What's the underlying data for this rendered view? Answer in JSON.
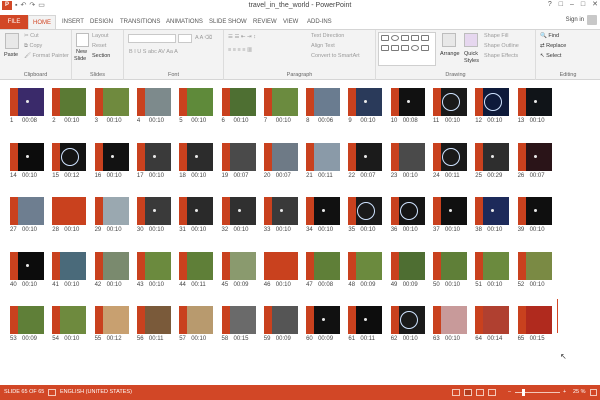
{
  "window": {
    "app_icon_letter": "P",
    "title": "travel_in_the_world - PowerPoint",
    "qat_icons": [
      "save-icon",
      "undo-icon",
      "redo-icon",
      "present-icon"
    ],
    "controls": [
      "?",
      "□",
      "–",
      "□",
      "✕"
    ]
  },
  "tabs": [
    {
      "label": "FILE"
    },
    {
      "label": "HOME"
    },
    {
      "label": "INSERT"
    },
    {
      "label": "DESIGN"
    },
    {
      "label": "TRANSITIONS"
    },
    {
      "label": "ANIMATIONS"
    },
    {
      "label": "SLIDE SHOW"
    },
    {
      "label": "REVIEW"
    },
    {
      "label": "VIEW"
    },
    {
      "label": "ADD-INS"
    }
  ],
  "sign_in": "Sign in",
  "ribbon": {
    "clipboard": {
      "label": "Clipboard",
      "paste": "Paste",
      "cut": "Cut",
      "copy": "Copy",
      "format_painter": "Format Painter"
    },
    "slides": {
      "label": "Slides",
      "new_slide": "New",
      "new_slide_2": "Slide",
      "layout": "Layout",
      "reset": "Reset",
      "section": "Section"
    },
    "font": {
      "label": "Font"
    },
    "paragraph": {
      "label": "Paragraph",
      "text_direction": "Text Direction",
      "align_text": "Align Text",
      "convert": "Convert to SmartArt"
    },
    "drawing": {
      "label": "Drawing",
      "arrange": "Arrange",
      "quick_styles": "Quick",
      "quick_styles_2": "Styles",
      "shape_fill": "Shape Fill",
      "shape_outline": "Shape Outline",
      "shape_effects": "Shape Effects"
    },
    "editing": {
      "label": "Editing",
      "find": "Find",
      "replace": "Replace",
      "select": "Select"
    }
  },
  "slides": [
    {
      "n": "1",
      "t": "00:08",
      "c": "#3a2a6a"
    },
    {
      "n": "2",
      "t": "00:10",
      "c": "#5b7a34"
    },
    {
      "n": "3",
      "t": "00:10",
      "c": "#6f8a3e"
    },
    {
      "n": "4",
      "t": "00:10",
      "c": "#7d8a8c"
    },
    {
      "n": "5",
      "t": "00:10",
      "c": "#5f8a3a"
    },
    {
      "n": "6",
      "t": "00:10",
      "c": "#4e6f32"
    },
    {
      "n": "7",
      "t": "00:10",
      "c": "#6b8b3f"
    },
    {
      "n": "8",
      "t": "00:06",
      "c": "#6a7c90"
    },
    {
      "n": "9",
      "t": "00:10",
      "c": "#2a3a5a"
    },
    {
      "n": "10",
      "t": "00:08",
      "c": "#111111"
    },
    {
      "n": "11",
      "t": "00:10",
      "c": "#1a1a1a"
    },
    {
      "n": "12",
      "t": "00:10",
      "c": "#0e1a3a"
    },
    {
      "n": "13",
      "t": "00:10",
      "c": "#101418"
    },
    {
      "n": "14",
      "t": "00:10",
      "c": "#0c0c0c"
    },
    {
      "n": "15",
      "t": "00:12",
      "c": "#141414"
    },
    {
      "n": "16",
      "t": "00:10",
      "c": "#121212"
    },
    {
      "n": "17",
      "t": "00:10",
      "c": "#3a3a3a"
    },
    {
      "n": "18",
      "t": "00:10",
      "c": "#2c2c2c"
    },
    {
      "n": "19",
      "t": "00:07",
      "c": "#4a4a4a"
    },
    {
      "n": "20",
      "t": "00:07",
      "c": "#6e7a86"
    },
    {
      "n": "21",
      "t": "00:11",
      "c": "#8a9aa8"
    },
    {
      "n": "22",
      "t": "00:07",
      "c": "#1b1b1b"
    },
    {
      "n": "23",
      "t": "00:10",
      "c": "#4a4a4a"
    },
    {
      "n": "24",
      "t": "00:11",
      "c": "#1a1a1a"
    },
    {
      "n": "25",
      "t": "00:29",
      "c": "#2e2e2e"
    },
    {
      "n": "26",
      "t": "00:07",
      "c": "#2a1418"
    },
    {
      "n": "27",
      "t": "00:10",
      "c": "#6e7e90"
    },
    {
      "n": "28",
      "t": "00:10",
      "c": "#c9411e"
    },
    {
      "n": "29",
      "t": "00:10",
      "c": "#9aa8b0"
    },
    {
      "n": "30",
      "t": "00:10",
      "c": "#3a3a3a"
    },
    {
      "n": "31",
      "t": "00:10",
      "c": "#2a2a2a"
    },
    {
      "n": "32",
      "t": "00:10",
      "c": "#303030"
    },
    {
      "n": "33",
      "t": "00:10",
      "c": "#3a3a3a"
    },
    {
      "n": "34",
      "t": "00:10",
      "c": "#111111"
    },
    {
      "n": "35",
      "t": "00:10",
      "c": "#1a1a1a"
    },
    {
      "n": "36",
      "t": "00:10",
      "c": "#151515"
    },
    {
      "n": "37",
      "t": "00:10",
      "c": "#101010"
    },
    {
      "n": "38",
      "t": "00:10",
      "c": "#1d2a5a"
    },
    {
      "n": "39",
      "t": "00:10",
      "c": "#0f0f0f"
    },
    {
      "n": "40",
      "t": "00:10",
      "c": "#0c0c0c"
    },
    {
      "n": "41",
      "t": "00:10",
      "c": "#4a6a7a"
    },
    {
      "n": "42",
      "t": "00:10",
      "c": "#7a8a6e"
    },
    {
      "n": "43",
      "t": "00:10",
      "c": "#6b8a3e"
    },
    {
      "n": "44",
      "t": "00:11",
      "c": "#5f7f38"
    },
    {
      "n": "45",
      "t": "00:09",
      "c": "#8a9a6e"
    },
    {
      "n": "46",
      "t": "00:10",
      "c": "#c9411e"
    },
    {
      "n": "47",
      "t": "00:08",
      "c": "#5f7f38"
    },
    {
      "n": "48",
      "t": "00:09",
      "c": "#6b8a3e"
    },
    {
      "n": "49",
      "t": "00:09",
      "c": "#4e6e32"
    },
    {
      "n": "50",
      "t": "00:10",
      "c": "#5f7f38"
    },
    {
      "n": "51",
      "t": "00:10",
      "c": "#6b8a3e"
    },
    {
      "n": "52",
      "t": "00:10",
      "c": "#7a8a44"
    },
    {
      "n": "53",
      "t": "00:09",
      "c": "#5f7f38"
    },
    {
      "n": "54",
      "t": "00:10",
      "c": "#6e8a3e"
    },
    {
      "n": "55",
      "t": "00:12",
      "c": "#c8a070"
    },
    {
      "n": "56",
      "t": "00:11",
      "c": "#7a5a3a"
    },
    {
      "n": "57",
      "t": "00:10",
      "c": "#b89a6e"
    },
    {
      "n": "58",
      "t": "00:15",
      "c": "#6a6a6a"
    },
    {
      "n": "59",
      "t": "00:09",
      "c": "#555555"
    },
    {
      "n": "60",
      "t": "00:09",
      "c": "#111111"
    },
    {
      "n": "61",
      "t": "00:11",
      "c": "#0d0d0d"
    },
    {
      "n": "62",
      "t": "00:10",
      "c": "#1a1a1a"
    },
    {
      "n": "63",
      "t": "00:10",
      "c": "#c89a9a"
    },
    {
      "n": "64",
      "t": "00:14",
      "c": "#b04030"
    },
    {
      "n": "65",
      "t": "00:15",
      "c": "#b02a1e"
    }
  ],
  "status": {
    "slide_info": "SLIDE 65 OF 65",
    "language": "ENGLISH (UNITED STATES)",
    "zoom": "25 %",
    "zoom_level": 0.25,
    "minus": "–",
    "plus": "+"
  },
  "colors": {
    "accent": "#d24726",
    "ribbon_bg": "#f3f3f3",
    "slide_band": "#c9411e"
  }
}
